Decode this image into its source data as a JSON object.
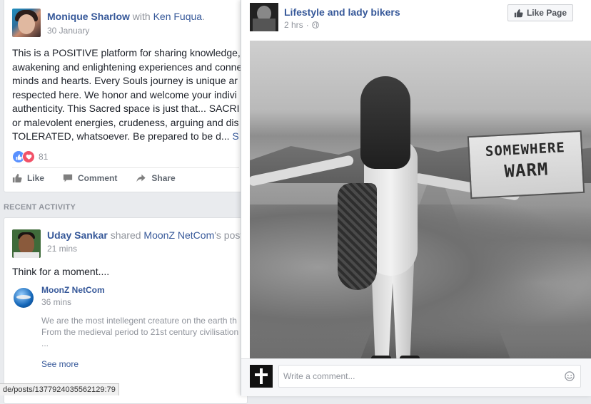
{
  "left_feed": {
    "post1": {
      "author": "Monique Sharlow",
      "with_word": "with",
      "with_name": "Ken Fuqua",
      "with_end": ".",
      "time": "30 January",
      "body_lines": [
        "This is a POSITIVE platform for sharing knowledge,",
        "awakening and enlightening experiences and conne",
        "minds and hearts. Every Souls journey is unique ar",
        "respected here. We honor and welcome your indivi",
        "authenticity. This Sacred space is just that... SACRI",
        "or malevolent energies, crudeness, arguing and dis"
      ],
      "body_last": "TOLERATED, whatsoever. Be prepared to be d... ",
      "see_more_inline": "S",
      "reaction_count": "81",
      "actions": {
        "like": "Like",
        "comment": "Comment",
        "share": "Share"
      }
    },
    "section_label": "RECENT ACTIVITY",
    "post2": {
      "author": "Uday Sankar",
      "verb": "shared",
      "page": "MoonZ NetCom",
      "possessive": "'s post",
      "time": "21 mins",
      "text": "Think for a moment....",
      "shared": {
        "name": "MoonZ NetCom",
        "time": "36 mins",
        "desc_lines": [
          "We are the most intellegent creature on the earth th",
          "From the medieval period to 21st century civilisation",
          "..."
        ],
        "see_more": "See more"
      }
    },
    "status_url": "de/posts/1377924035562129:79"
  },
  "popup": {
    "page_name": "Lifestyle and lady bikers",
    "time": "2 hrs",
    "like_page_label": "Like Page",
    "photo_sign_line1": "SOMEWHERE",
    "photo_sign_line2": "WARM",
    "comment_placeholder": "Write a comment...",
    "icons": [
      "thumb-up-icon",
      "globe-icon",
      "emoji-icon",
      "comment-icon",
      "share-icon"
    ]
  },
  "colors": {
    "link": "#365899",
    "background": "#e9ebee",
    "like_reaction": "#5890ff",
    "love_reaction": "#f25268"
  }
}
